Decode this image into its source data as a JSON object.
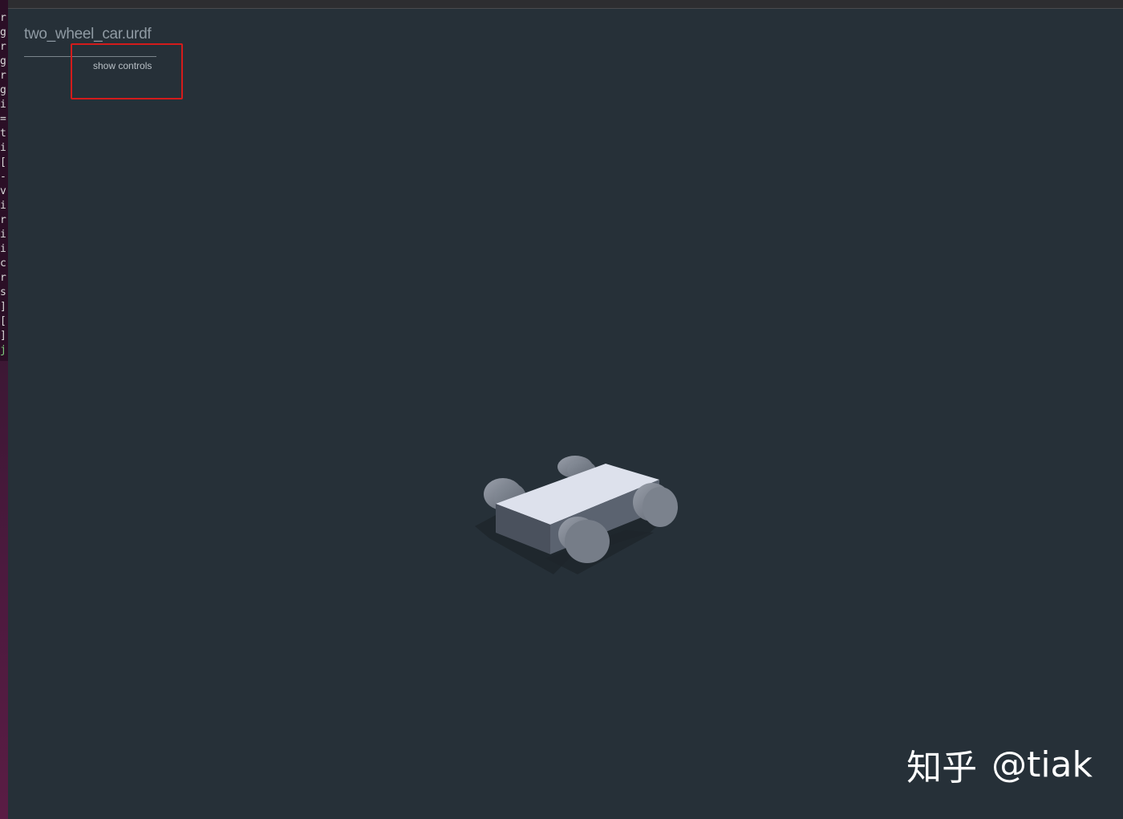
{
  "viewer": {
    "title": "two_wheel_car.urdf",
    "show_controls_label": "show controls",
    "highlight_color": "#d41b1b"
  },
  "terminal": {
    "visible_chars": [
      "r",
      "g",
      "r",
      "g",
      "r",
      "g",
      "i",
      "=",
      "t",
      "i",
      "[",
      "-",
      "v",
      "i",
      "r",
      "i",
      "i",
      "c",
      "r",
      "s",
      "]",
      "[",
      "]",
      "j"
    ]
  },
  "robot": {
    "body_color": "#dde1ec",
    "shadow_color": "#1f262c"
  },
  "watermark": {
    "brand": "知乎",
    "handle": "@tiak"
  }
}
